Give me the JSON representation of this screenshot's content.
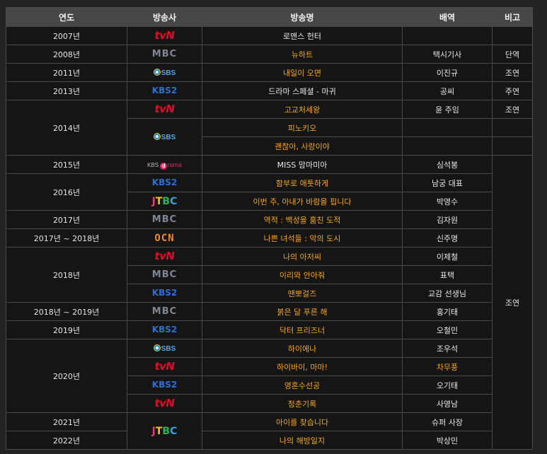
{
  "headers": [
    "연도",
    "방송사",
    "방송명",
    "배역",
    "비고"
  ],
  "logos": {
    "tvN": {
      "text": "tvN",
      "icon": "tvn-logo-icon",
      "color": "#e10a2b"
    },
    "MBC": {
      "text": "MBC",
      "icon": "mbc-logo-icon",
      "color": "#7f8791"
    },
    "KBS2": {
      "text": "KBS2",
      "icon": "kbs2-logo-icon",
      "color": "#2d6fd6"
    },
    "SBS": {
      "text": "SBS",
      "icon": "sbs-logo-icon",
      "color": "#4fa8e8"
    },
    "OCN": {
      "text": "OCN",
      "icon": "ocn-logo-icon",
      "color": "#f08a1c"
    },
    "JTBC": {
      "text": "JTBC",
      "icon": "jtbc-logo-icon",
      "color": "#e83b6e"
    },
    "KBSdrama": {
      "text": "KBS drama",
      "icon": "kbs-drama-logo-icon",
      "color": "#e4215e"
    }
  },
  "rows": [
    {
      "year": "2007년",
      "yearSpan": 1,
      "network": "tvN",
      "netSpan": 1,
      "title": "로맨스 헌터",
      "link": false,
      "role": "",
      "roleLink": false,
      "note": "",
      "noteSpan": 1
    },
    {
      "year": "2008년",
      "yearSpan": 1,
      "network": "MBC",
      "netSpan": 1,
      "title": "뉴하트",
      "link": true,
      "role": "택시기사",
      "roleLink": false,
      "note": "단역",
      "noteSpan": 1
    },
    {
      "year": "2011년",
      "yearSpan": 1,
      "network": "SBS",
      "netSpan": 1,
      "title": "내일이 오면",
      "link": true,
      "role": "이진규",
      "roleLink": false,
      "note": "조연",
      "noteSpan": 1
    },
    {
      "year": "2013년",
      "yearSpan": 1,
      "network": "KBS2",
      "netSpan": 1,
      "title": "드라마 스페셜 - 마귀",
      "link": false,
      "role": "공씨",
      "roleLink": false,
      "note": "주연",
      "noteSpan": 1
    },
    {
      "year": "2014년",
      "yearSpan": 3,
      "network": "tvN",
      "netSpan": 1,
      "title": "고교처세왕",
      "link": true,
      "role": "윤 주임",
      "roleLink": false,
      "note": "조연",
      "noteSpan": 1
    },
    {
      "year": null,
      "yearSpan": 0,
      "network": "SBS",
      "netSpan": 2,
      "title": "피노키오",
      "link": true,
      "role": "",
      "roleLink": false,
      "note": "",
      "noteSpan": 1
    },
    {
      "year": null,
      "yearSpan": 0,
      "network": null,
      "netSpan": 0,
      "title": "괜찮아, 사랑이야",
      "link": true,
      "role": "",
      "roleLink": false,
      "note": "",
      "noteSpan": 1
    },
    {
      "year": "2015년",
      "yearSpan": 1,
      "network": "KBSdrama",
      "netSpan": 1,
      "title": "MISS 맘마미아",
      "link": false,
      "role": "심석봉",
      "roleLink": false,
      "note": "조연",
      "noteSpan": 17
    },
    {
      "year": "2016년",
      "yearSpan": 2,
      "network": "KBS2",
      "netSpan": 1,
      "title": "함부로 애틋하게",
      "link": true,
      "role": "남궁 대표",
      "roleLink": false,
      "note": null,
      "noteSpan": 0
    },
    {
      "year": null,
      "yearSpan": 0,
      "network": "JTBC",
      "netSpan": 1,
      "title": "이번 주, 아내가 바람을 핍니다",
      "link": true,
      "role": "박영수",
      "roleLink": false,
      "note": null,
      "noteSpan": 0
    },
    {
      "year": "2017년",
      "yearSpan": 1,
      "network": "MBC",
      "netSpan": 1,
      "title": "역적 : 백성을 훔친 도적",
      "link": true,
      "role": "김자원",
      "roleLink": false,
      "note": null,
      "noteSpan": 0
    },
    {
      "year": "2017년 ~ 2018년",
      "yearSpan": 1,
      "network": "OCN",
      "netSpan": 1,
      "title": "나쁜 녀석들 : 악의 도시",
      "link": true,
      "role": "신주명",
      "roleLink": false,
      "note": null,
      "noteSpan": 0
    },
    {
      "year": "2018년",
      "yearSpan": 3,
      "network": "tvN",
      "netSpan": 1,
      "title": "나의 아저씨",
      "link": true,
      "role": "이제철",
      "roleLink": false,
      "note": null,
      "noteSpan": 0
    },
    {
      "year": null,
      "yearSpan": 0,
      "network": "MBC",
      "netSpan": 1,
      "title": "이리와 안아줘",
      "link": true,
      "role": "표택",
      "roleLink": false,
      "note": null,
      "noteSpan": 0
    },
    {
      "year": null,
      "yearSpan": 0,
      "network": "KBS2",
      "netSpan": 1,
      "title": "땐뽀걸즈",
      "link": true,
      "role": "교감 선생님",
      "roleLink": false,
      "note": null,
      "noteSpan": 0
    },
    {
      "year": "2018년 ~ 2019년",
      "yearSpan": 1,
      "network": "MBC",
      "netSpan": 1,
      "title": "붉은 달 푸른 해",
      "link": true,
      "role": "홍기태",
      "roleLink": false,
      "note": null,
      "noteSpan": 0
    },
    {
      "year": "2019년",
      "yearSpan": 1,
      "network": "KBS2",
      "netSpan": 1,
      "title": "닥터 프리즈너",
      "link": true,
      "role": "오철민",
      "roleLink": false,
      "note": null,
      "noteSpan": 0
    },
    {
      "year": "2020년",
      "yearSpan": 4,
      "network": "SBS",
      "netSpan": 1,
      "title": "하이에나",
      "link": true,
      "role": "조우석",
      "roleLink": false,
      "note": null,
      "noteSpan": 0
    },
    {
      "year": null,
      "yearSpan": 0,
      "network": "tvN",
      "netSpan": 1,
      "title": "하이바이, 마마!",
      "link": true,
      "role": "차무풍",
      "roleLink": true,
      "note": null,
      "noteSpan": 0
    },
    {
      "year": null,
      "yearSpan": 0,
      "network": "KBS2",
      "netSpan": 1,
      "title": "영혼수선공",
      "link": true,
      "role": "오기태",
      "roleLink": false,
      "note": null,
      "noteSpan": 0
    },
    {
      "year": null,
      "yearSpan": 0,
      "network": "tvN",
      "netSpan": 1,
      "title": "청춘기록",
      "link": true,
      "role": "사영남",
      "roleLink": false,
      "note": null,
      "noteSpan": 0
    },
    {
      "year": "2021년",
      "yearSpan": 1,
      "network": "JTBC",
      "netSpan": 2,
      "title": "아이를 찾습니다",
      "link": true,
      "role": "슈퍼 사장",
      "roleLink": false,
      "note": "",
      "noteSpan": 1
    },
    {
      "year": "2022년",
      "yearSpan": 1,
      "network": null,
      "netSpan": 0,
      "title": "나의 해방일지",
      "link": true,
      "role": "박상민",
      "roleLink": false,
      "note": "",
      "noteSpan": 1
    }
  ]
}
